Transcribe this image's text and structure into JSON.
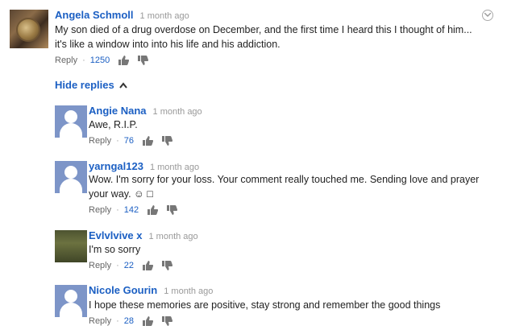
{
  "top_comment": {
    "author": "Angela Schmoll",
    "time": "1 month ago",
    "text_line1": "My son died of a drug overdose on December, and the first time I heard this I thought of him...",
    "text_line2": "it's like a window into into his life and his addiction.",
    "reply_label": "Reply",
    "likes": "1250"
  },
  "hide_replies_label": "Hide replies",
  "replies": [
    {
      "author": "Angie Nana",
      "time": "1 month ago",
      "text_line1": "Awe, R.I.P.",
      "text_line2": "",
      "reply_label": "Reply",
      "likes": "76"
    },
    {
      "author": "yarngal123",
      "time": "1 month ago",
      "text_line1": "Wow. I'm sorry for your loss. Your comment really touched me. Sending love and prayer",
      "text_line2": "your way. ☺ □",
      "reply_label": "Reply",
      "likes": "142"
    },
    {
      "author": "Evlvlvive x",
      "time": "1 month ago",
      "text_line1": "I'm so sorry",
      "text_line2": "",
      "reply_label": "Reply",
      "likes": "22"
    },
    {
      "author": "Nicole Gourin",
      "time": "1 month ago",
      "text_line1": "I hope these memories are positive, stay strong and remember the good things",
      "text_line2": "",
      "reply_label": "Reply",
      "likes": "28"
    }
  ],
  "colors": {
    "author": "#1b5fc3",
    "avatar_default": "#7d95c8"
  }
}
